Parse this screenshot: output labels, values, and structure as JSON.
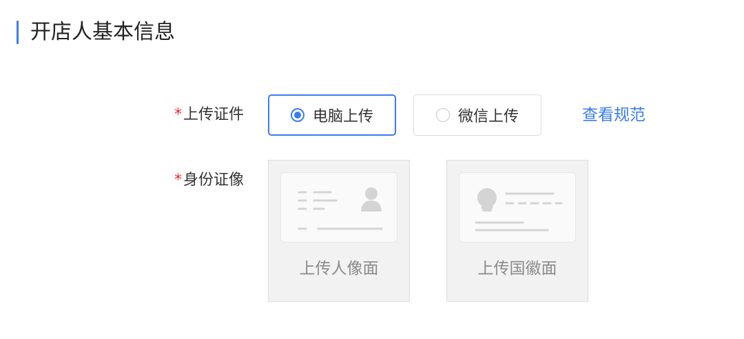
{
  "section": {
    "title": "开店人基本信息",
    "accent_color": "#3a7bf2"
  },
  "form": {
    "upload_method": {
      "required_mark": "*",
      "label": "上传证件",
      "options": [
        {
          "label": "电脑上传",
          "selected": true
        },
        {
          "label": "微信上传",
          "selected": false
        }
      ],
      "spec_link": "查看规范"
    },
    "id_photo": {
      "required_mark": "*",
      "label": "身份证像",
      "portrait_upload": {
        "text": "上传人像面",
        "icon": "id-card-portrait-icon"
      },
      "emblem_upload": {
        "text": "上传国徽面",
        "icon": "id-card-emblem-icon"
      }
    }
  }
}
